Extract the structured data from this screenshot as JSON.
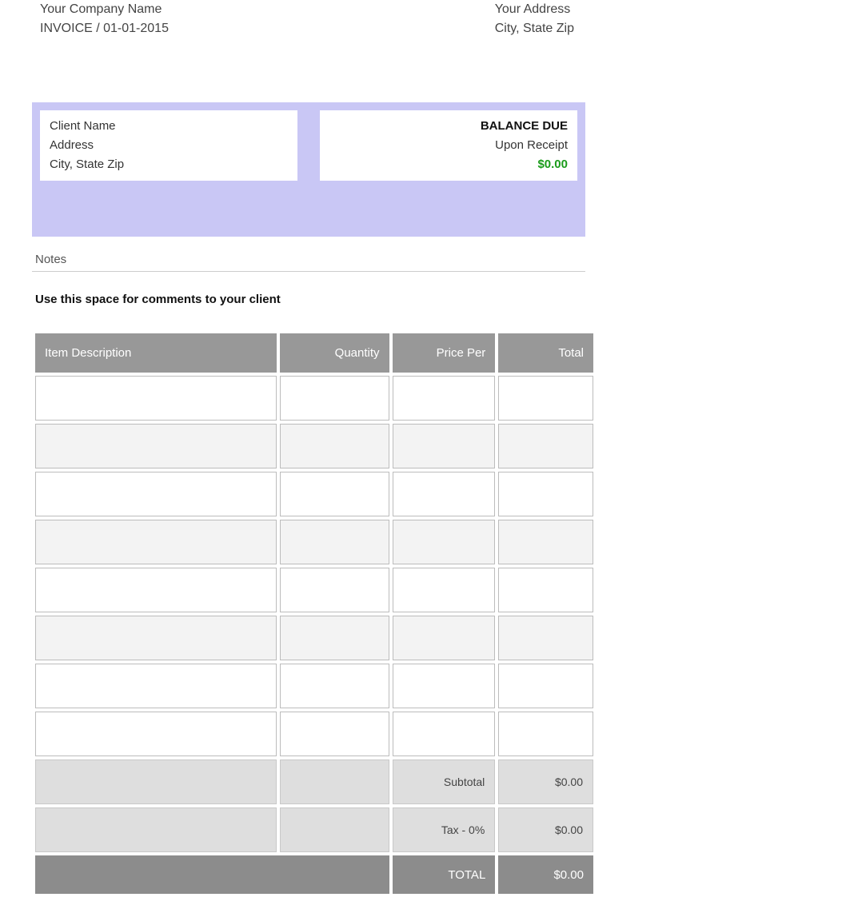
{
  "header": {
    "company_name": "Your Company Name",
    "invoice_line": "INVOICE / 01-01-2015",
    "your_address": "Your Address",
    "your_city_state_zip": "City, State Zip"
  },
  "client_box": {
    "client_name": "Client Name",
    "address": "Address",
    "city_state_zip": "City, State Zip"
  },
  "balance_box": {
    "balance_due_label": "BALANCE DUE",
    "terms": "Upon Receipt",
    "amount": "$0.00"
  },
  "notes": {
    "label": "Notes",
    "comments_label": "Use this space for comments to your client"
  },
  "table": {
    "headers": {
      "description": "Item Description",
      "quantity": "Quantity",
      "price_per": "Price Per",
      "total": "Total"
    },
    "summary": {
      "subtotal_label": "Subtotal",
      "subtotal_value": "$0.00",
      "tax_label": "Tax - 0%",
      "tax_value": "$0.00",
      "total_label": "TOTAL",
      "total_value": "$0.00"
    }
  }
}
